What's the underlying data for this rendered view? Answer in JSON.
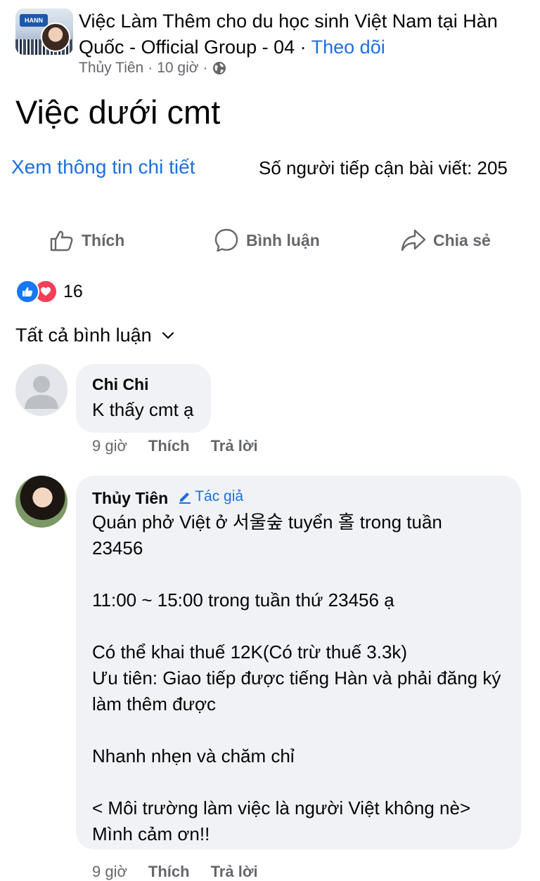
{
  "group": {
    "name": "Việc Làm Thêm cho du học sinh Việt Nam tại Hàn Quốc - Official Group - 04",
    "separator": " · ",
    "follow_label": "Theo dõi",
    "avatar_logo_text": "HANN"
  },
  "post": {
    "author": "Thủy Tiên",
    "time": "10 giờ",
    "dot": "·",
    "privacy_icon": "globe-icon",
    "text": "Việc dưới cmt",
    "details_link": "Xem thông tin chi tiết",
    "reach_text": "Số người tiếp cận bài viết: 205"
  },
  "actions": {
    "like": "Thích",
    "comment": "Bình luận",
    "share": "Chia sẻ"
  },
  "reactions": {
    "icons": [
      "like-icon",
      "love-icon"
    ],
    "count": "16"
  },
  "comments_filter": "Tất cả bình luận",
  "comments": [
    {
      "name": "Chi Chi",
      "text": "K thấy cmt ạ",
      "time": "9 giờ",
      "like": "Thích",
      "reply": "Trả lời"
    },
    {
      "name": "Thủy Tiên",
      "badge": "Tác giả",
      "text": "Quán phở Việt ở 서울숲 tuyển 홀 trong tuần\n23456\n\n11:00 ~ 15:00 trong tuần thứ 23456 ạ\n\nCó thể khai thuế 12K(Có trừ thuế 3.3k)\nƯu tiên: Giao tiếp được tiếng Hàn và phải đăng ký làm thêm được\n\nNhanh nhẹn và chăm chỉ\n\n< Môi trường làm việc là người Việt không nè>\nMình cảm ơn!!",
      "time": "9 giờ",
      "like": "Thích",
      "reply": "Trả lời"
    }
  ],
  "colors": {
    "link": "#1d6fe0",
    "secondary_text": "#65676b",
    "bubble": "#f0f2f5",
    "like": "#1877f2",
    "love": "#f33e58"
  }
}
